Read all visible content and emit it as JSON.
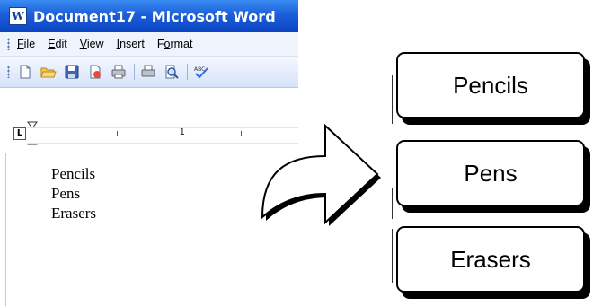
{
  "window": {
    "title": "Document17 - Microsoft Word",
    "app_icon": "word-doc-icon"
  },
  "menu": {
    "items": [
      {
        "pre": "",
        "ul": "F",
        "post": "ile"
      },
      {
        "pre": "",
        "ul": "E",
        "post": "dit"
      },
      {
        "pre": "",
        "ul": "V",
        "post": "iew"
      },
      {
        "pre": "",
        "ul": "I",
        "post": "nsert"
      },
      {
        "pre": "F",
        "ul": "o",
        "post": "rmat"
      }
    ]
  },
  "toolbar": {
    "icons": [
      "new-document-icon",
      "open-folder-icon",
      "save-icon",
      "permission-icon",
      "print-icon",
      "print-preview-icon",
      "spelling-icon"
    ]
  },
  "ruler": {
    "label": "1",
    "tab_stop": "L"
  },
  "document": {
    "lines": [
      "Pencils",
      "Pens",
      "Erasers"
    ]
  },
  "diagram": {
    "boxes": [
      "Pencils",
      "Pens",
      "Erasers"
    ]
  },
  "colors": {
    "title_bar": "#1c5fd8",
    "menu_bar": "#eef3fc",
    "toolbar": "#d6e3f9"
  }
}
